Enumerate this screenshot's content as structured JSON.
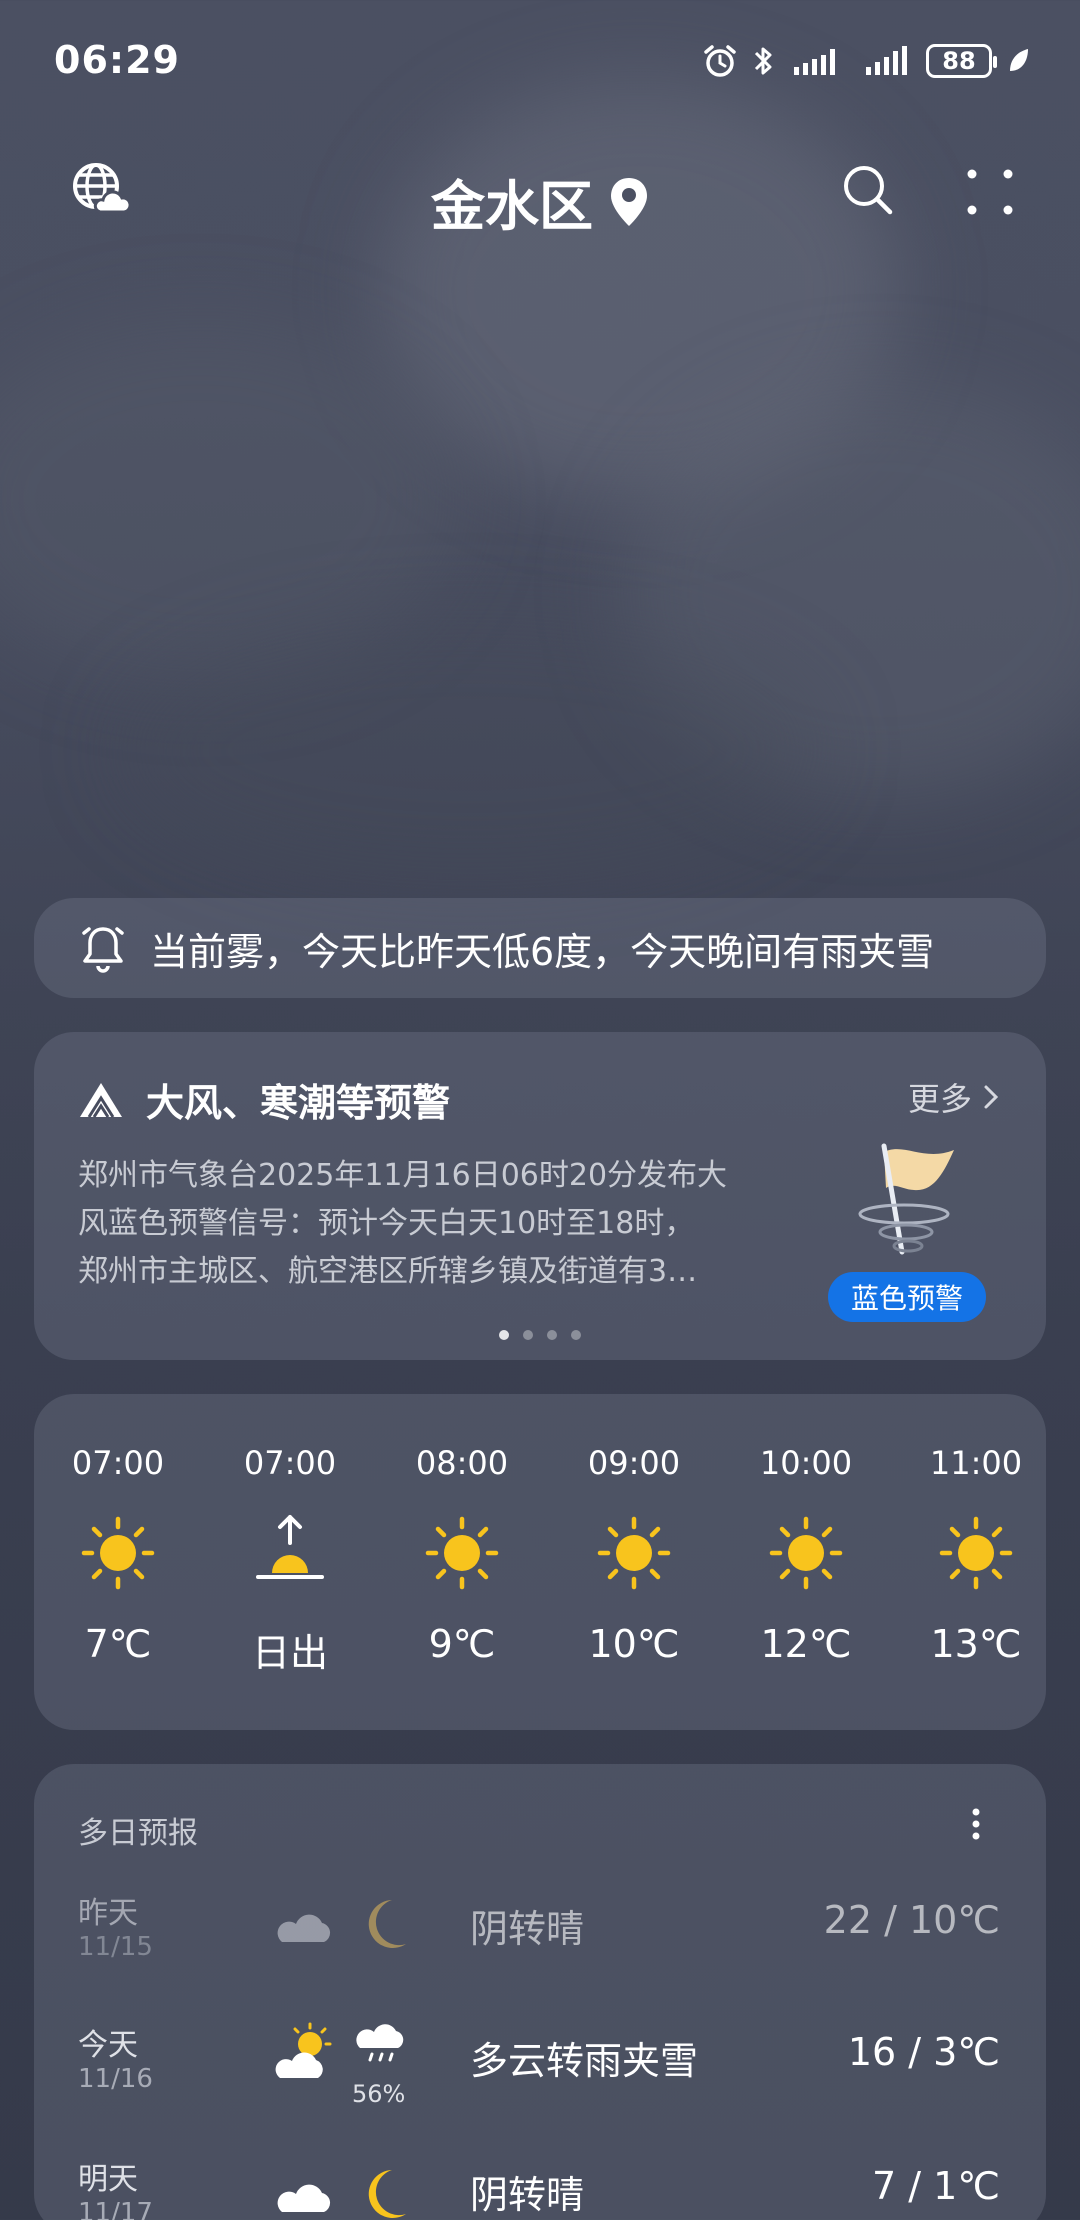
{
  "status_bar": {
    "time": "06:29",
    "battery": "88"
  },
  "header": {
    "city": "金水区"
  },
  "banner": {
    "text": "当前雾，今天比昨天低6度，今天晚间有雨夹雪"
  },
  "alert": {
    "title": "大风、寒潮等预警",
    "more_label": "更多",
    "lines": [
      "郑州市气象台2025年11月16日06时20分发布大",
      "风蓝色预警信号：预计今天白天10时至18时，",
      "郑州市主城区、航空港区所辖乡镇及街道有3…"
    ],
    "badge": "蓝色预警",
    "badge_color": "#1473e6",
    "page_count": 4,
    "active_page": 1
  },
  "hourly": [
    {
      "time": "07:00",
      "icon": "sun-icon",
      "value": "7℃"
    },
    {
      "time": "07:00",
      "icon": "sunrise-icon",
      "value": "日出"
    },
    {
      "time": "08:00",
      "icon": "sun-icon",
      "value": "9℃"
    },
    {
      "time": "09:00",
      "icon": "sun-icon",
      "value": "10℃"
    },
    {
      "time": "10:00",
      "icon": "sun-icon",
      "value": "12℃"
    },
    {
      "time": "11:00",
      "icon": "sun-icon",
      "value": "13℃"
    }
  ],
  "daily": {
    "title": "多日预报",
    "rows": [
      {
        "day": "昨天",
        "date": "11/15",
        "day_icon": "cloud-icon",
        "night_icon": "moon-icon",
        "desc": "阴转晴",
        "temp": "22 / 10℃",
        "dim": true
      },
      {
        "day": "今天",
        "date": "11/16",
        "day_icon": "partly-cloudy-icon",
        "night_icon": "sleet-icon",
        "precip": "56%",
        "desc": "多云转雨夹雪",
        "temp": "16 / 3℃",
        "dim": false
      },
      {
        "day": "明天",
        "date": "11/17",
        "day_icon": "cloud-icon",
        "night_icon": "moon-icon",
        "desc": "阴转晴",
        "temp": "7 / 1℃",
        "dim": false
      }
    ]
  },
  "colors": {
    "sun": "#f8c41d",
    "accent_blue": "#1473e6"
  }
}
